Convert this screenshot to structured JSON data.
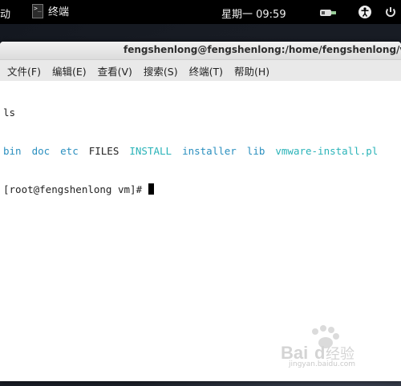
{
  "topbar": {
    "activities_label": "动",
    "app_name": "终端",
    "terminal_icon_glyph": ">_",
    "clock": "星期一 09:59",
    "icons": [
      "terminal-icon",
      "network-icon",
      "accessibility-icon",
      "power-icon"
    ]
  },
  "window": {
    "title": "fengshenlong@fengshenlong:/home/fengshenlong/vm",
    "menu": [
      {
        "label": "文件(F)"
      },
      {
        "label": "编辑(E)"
      },
      {
        "label": "查看(V)"
      },
      {
        "label": "搜索(S)"
      },
      {
        "label": "终端(T)"
      },
      {
        "label": "帮助(H)"
      }
    ]
  },
  "terminal": {
    "command": "ls",
    "ls_output": [
      {
        "name": "bin",
        "color": "#2a8fbf"
      },
      {
        "name": "doc",
        "color": "#2a8fbf"
      },
      {
        "name": "etc",
        "color": "#2a8fbf"
      },
      {
        "name": "FILES",
        "color": "#222222"
      },
      {
        "name": "INSTALL",
        "color": "#2ab3b8"
      },
      {
        "name": "installer",
        "color": "#2a8fbf"
      },
      {
        "name": "lib",
        "color": "#2a8fbf"
      },
      {
        "name": "vmware-install.pl",
        "color": "#2ab3b8"
      }
    ],
    "prompt": "[root@fengshenlong vm]# "
  },
  "watermark": {
    "text": "Bai 经验",
    "url_text": "jingyan.baidu.com"
  }
}
